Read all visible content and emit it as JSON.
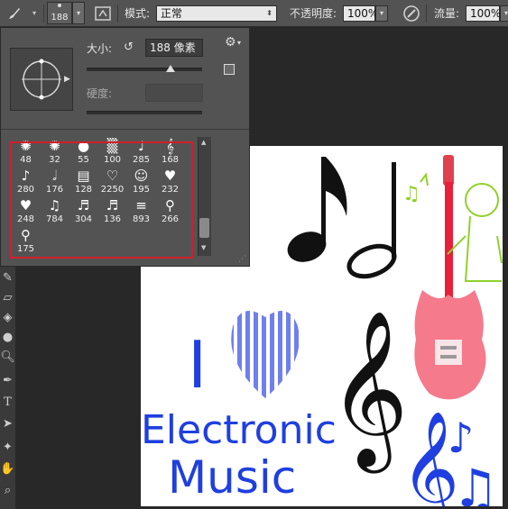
{
  "options_bar": {
    "brush_size": "188",
    "mode_label": "模式:",
    "mode_value": "正常",
    "opacity_label": "不透明度:",
    "opacity_value": "100%",
    "flow_label": "流量:",
    "flow_value": "100%"
  },
  "brush_picker": {
    "size_label": "大小:",
    "size_value": "188 像素",
    "hardness_label": "硬度:",
    "presets": [
      {
        "icon": "splatter-brush",
        "num": "48"
      },
      {
        "icon": "splatter-brush",
        "num": "32"
      },
      {
        "icon": "round-soft-brush",
        "num": "55"
      },
      {
        "icon": "texture-brush",
        "num": "100"
      },
      {
        "icon": "guitar-brush",
        "num": "285"
      },
      {
        "icon": "treble-clef-brush",
        "num": "168"
      },
      {
        "icon": "eighth-note-brush",
        "num": "280"
      },
      {
        "icon": "half-note-brush",
        "num": "176"
      },
      {
        "icon": "cards-brush",
        "num": "128"
      },
      {
        "icon": "heart-brush",
        "num": "2250"
      },
      {
        "icon": "smiley-brush",
        "num": "195"
      },
      {
        "icon": "i-love-pop-brush",
        "num": "232"
      },
      {
        "icon": "i-love-music-brush",
        "num": "248"
      },
      {
        "icon": "music-staff-brush",
        "num": "784"
      },
      {
        "icon": "notes-brush",
        "num": "304"
      },
      {
        "icon": "notes-cluster-brush",
        "num": "136"
      },
      {
        "icon": "staff-lines-brush",
        "num": "893"
      },
      {
        "icon": "guitar-small-brush",
        "num": "266"
      },
      {
        "icon": "guitar-tiny-brush",
        "num": "175"
      }
    ]
  },
  "canvas_art": {
    "line1": "I",
    "line2": "Electronic",
    "line3": "Music",
    "treble_clef": "𝄞",
    "beamed_notes": "♫",
    "eighth_note": "♪"
  },
  "colors": {
    "panel_bg": "#535353",
    "workspace_bg": "#282828",
    "selection_border": "#d0202b",
    "text_blue": "#1f3fe0",
    "heart_stripe": "#6f7ff0",
    "guitar_pink": "#f47a8c"
  }
}
